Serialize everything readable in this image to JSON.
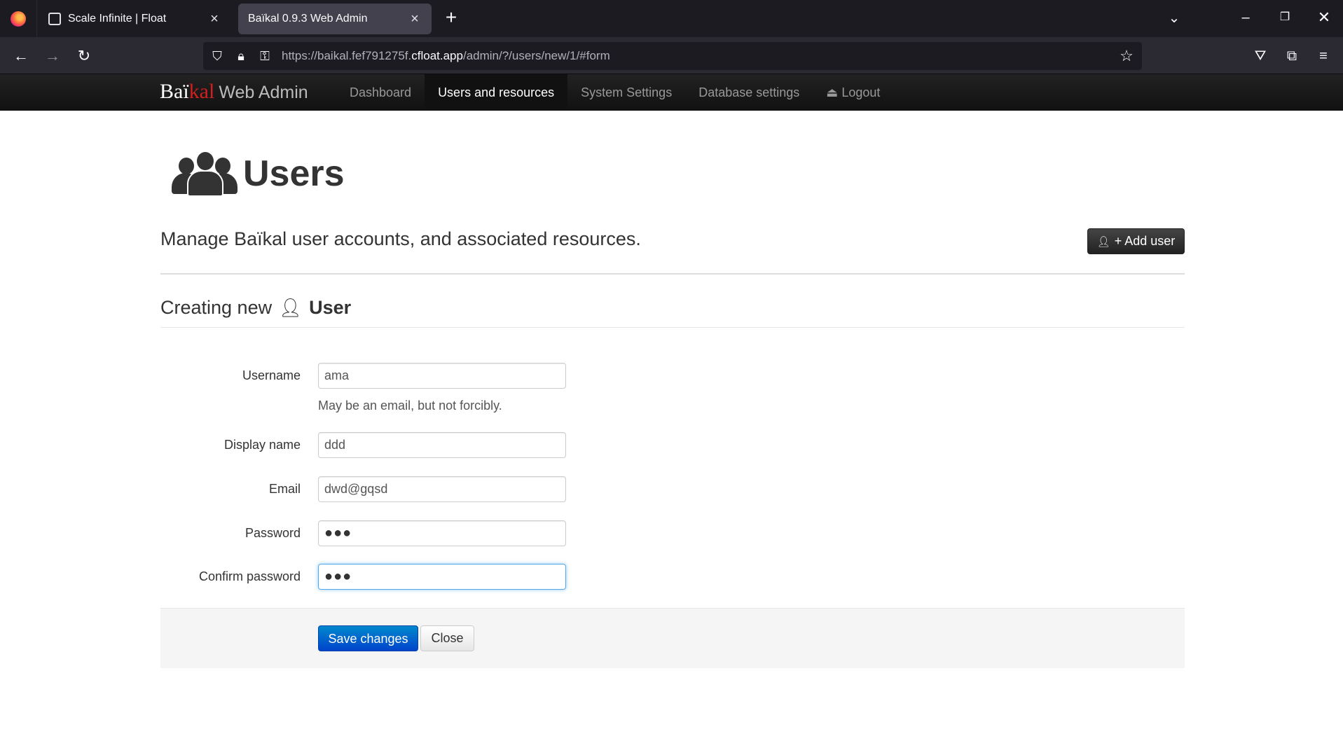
{
  "browser": {
    "tabs": [
      {
        "label": "Scale Infinite | Float",
        "active": false
      },
      {
        "label": "Baïkal 0.9.3 Web Admin",
        "active": true
      }
    ],
    "url_prefix": "https://baikal.fef791275f.",
    "url_domain": "cfloat.app",
    "url_suffix": "/admin/?/users/new/1/#form"
  },
  "site": {
    "brand_part1": "Baï",
    "brand_part2": "kal",
    "brand_sub": "Web Admin",
    "nav": [
      {
        "label": "Dashboard",
        "active": false
      },
      {
        "label": "Users and resources",
        "active": true
      },
      {
        "label": "System Settings",
        "active": false
      },
      {
        "label": "Database settings",
        "active": false
      },
      {
        "label": "Logout",
        "active": false
      }
    ]
  },
  "page": {
    "title": "Users",
    "lead": "Manage Baïkal user accounts, and associated resources.",
    "add_user_label": "+ Add user"
  },
  "form": {
    "legend_prefix": "Creating new",
    "legend_entity": "User",
    "fields": {
      "username": {
        "label": "Username",
        "value": "ama",
        "help": "May be an email, but not forcibly."
      },
      "display_name": {
        "label": "Display name",
        "value": "ddd"
      },
      "email": {
        "label": "Email",
        "value": "dwd@gqsd"
      },
      "password": {
        "label": "Password",
        "value": "●●●"
      },
      "confirm_password": {
        "label": "Confirm password",
        "value": "●●●"
      }
    },
    "save_label": "Save changes",
    "close_label": "Close"
  },
  "colors": {
    "accent_primary": "#0055cc",
    "brand_red": "#d21f1f",
    "navbar_bg": "#1b1b1b"
  }
}
